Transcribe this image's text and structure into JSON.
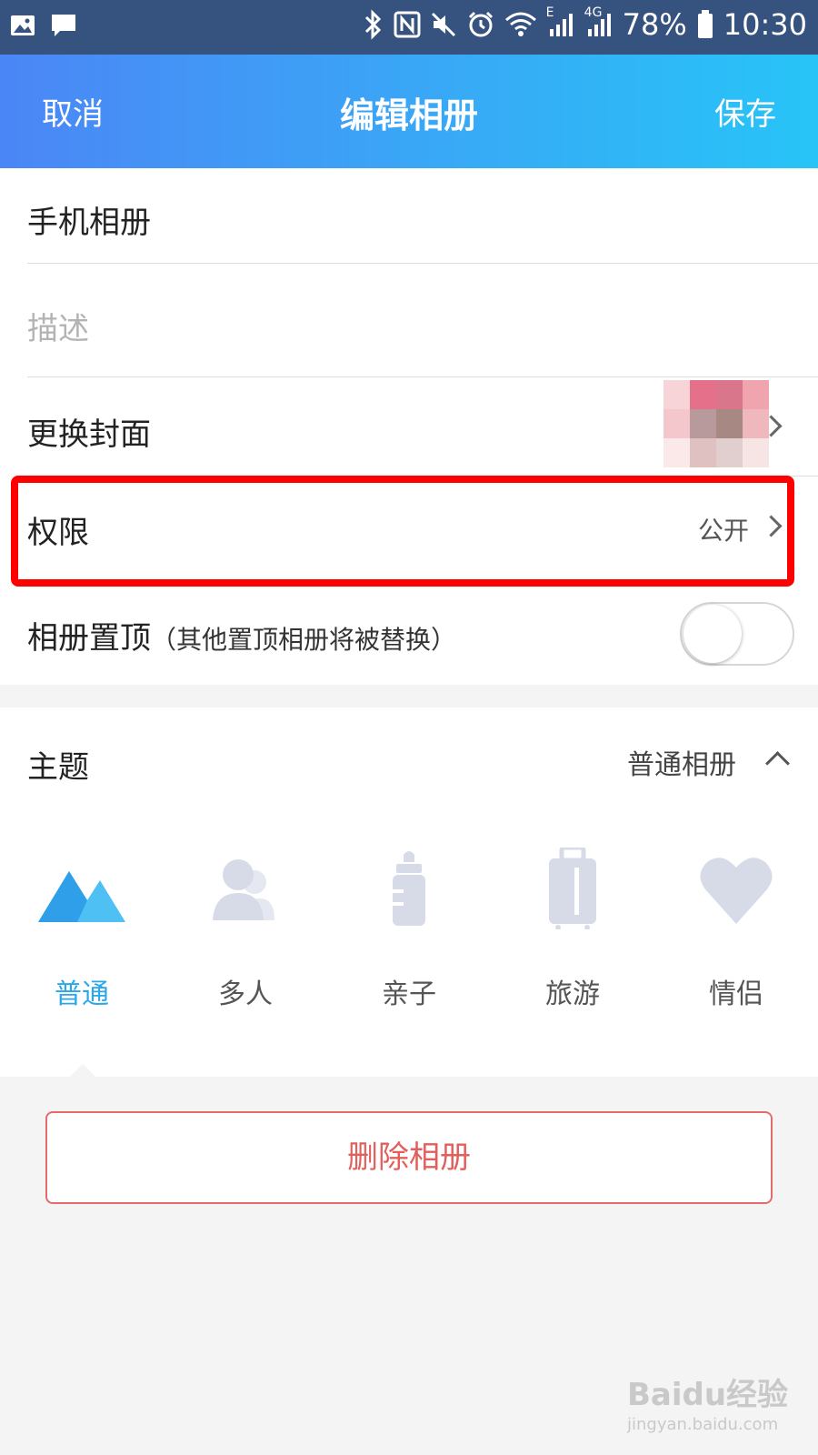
{
  "status_bar": {
    "battery": "78%",
    "time": "10:30",
    "signal_small_1": "E",
    "signal_small_2": "4G",
    "icons": [
      "image-icon",
      "message-icon",
      "bluetooth-icon",
      "nfc-icon",
      "mute-icon",
      "alarm-icon",
      "wifi-icon",
      "signal-icon",
      "signal-icon",
      "battery-icon"
    ]
  },
  "nav": {
    "cancel": "取消",
    "title": "编辑相册",
    "save": "保存"
  },
  "form": {
    "album_name": "手机相册",
    "description_placeholder": "描述",
    "change_cover": "更换封面",
    "permission_label": "权限",
    "permission_value": "公开",
    "pin_label": "相册置顶",
    "pin_note": "（其他置顶相册将被替换）",
    "pin_enabled": false
  },
  "theme": {
    "label": "主题",
    "selected_value": "普通相册",
    "items": [
      {
        "label": "普通",
        "icon": "mountain-icon",
        "selected": true
      },
      {
        "label": "多人",
        "icon": "people-icon",
        "selected": false
      },
      {
        "label": "亲子",
        "icon": "baby-bottle-icon",
        "selected": false
      },
      {
        "label": "旅游",
        "icon": "suitcase-icon",
        "selected": false
      },
      {
        "label": "情侣",
        "icon": "heart-icon",
        "selected": false
      }
    ]
  },
  "delete_button": "删除相册",
  "watermark": {
    "line1": "Baidu经验",
    "line2": "jingyan.baidu.com"
  },
  "colors": {
    "accent": "#2aa7ea",
    "inactive_icon": "#d9dce8",
    "delete": "#e25f5c",
    "highlight": "#ff0000"
  }
}
